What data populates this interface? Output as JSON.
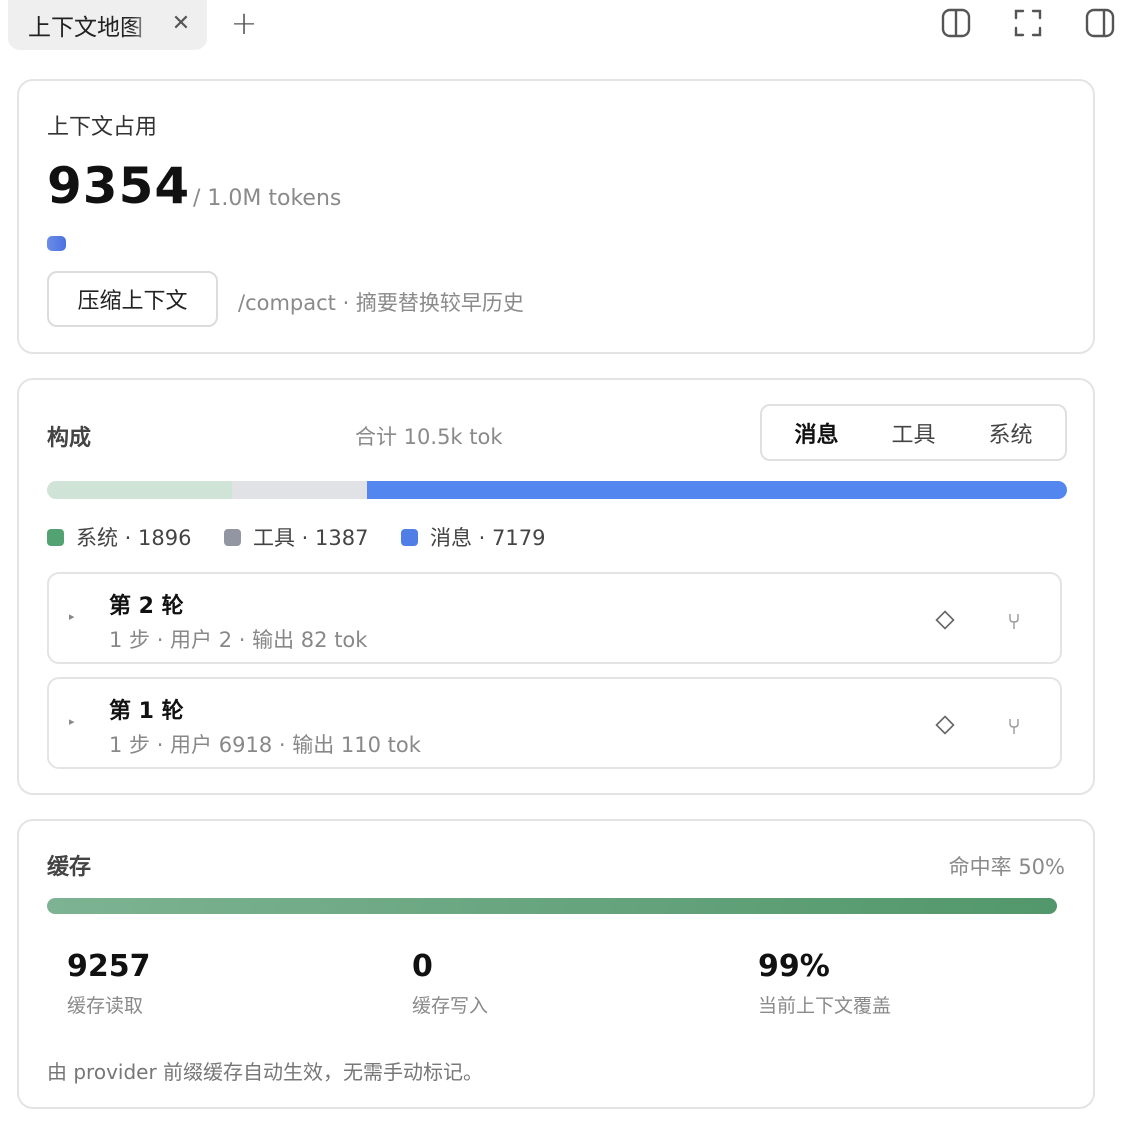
{
  "tab": {
    "title": "上下文地图",
    "close": "✕",
    "add": "+"
  },
  "usage": {
    "heading": "上下文占用",
    "tokens": "9354",
    "limit": "/ 1.0M tokens",
    "compact_button": "压缩上下文",
    "compact_hint": "/compact · 摘要替换较早历史"
  },
  "composition": {
    "heading": "构成",
    "total": "合计 10.5k tok",
    "tabs": [
      "消息",
      "工具",
      "系统"
    ],
    "active_tab": "消息",
    "legend": [
      {
        "label": "系统 · 1896",
        "value": 1896,
        "color": "#53a271"
      },
      {
        "label": "工具 · 1387",
        "value": 1387,
        "color": "#9196a2"
      },
      {
        "label": "消息 · 7179",
        "value": 7179,
        "color": "#4f7fe6"
      }
    ],
    "bar_colors": {
      "system": "#cfe3d6",
      "tool": "#e1e2e6",
      "message": "#5486ef"
    },
    "turns": [
      {
        "title": "第 2 轮",
        "subtitle": "1 步 · 用户 2 · 输出 82 tok",
        "caret": "▸"
      },
      {
        "title": "第 1 轮",
        "subtitle": "1 步 · 用户 6918 · 输出 110 tok",
        "caret": "▸"
      }
    ]
  },
  "cache": {
    "heading": "缓存",
    "hit_rate": "命中率 50%",
    "stats": [
      {
        "value": "9257",
        "label": "缓存读取"
      },
      {
        "value": "0",
        "label": "缓存写入"
      },
      {
        "value": "99%",
        "label": "当前上下文覆盖"
      }
    ],
    "footnote": "由 provider 前缀缓存自动生效，无需手动标记。"
  }
}
